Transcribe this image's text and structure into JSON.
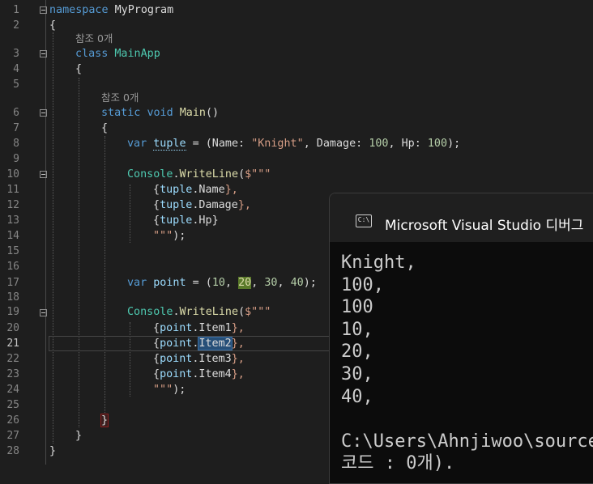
{
  "editor": {
    "current_line": 21,
    "ref_labels": {
      "line3": "참조 0개",
      "line6": "참조 0개"
    },
    "lines": {
      "l1": {
        "kw": "namespace",
        "name": "MyProgram"
      },
      "l2": "{",
      "l3": {
        "kw": "class",
        "name": "MainApp"
      },
      "l4": "{",
      "l6": {
        "kw1": "static",
        "kw2": "void",
        "name": "Main",
        "tail": "()"
      },
      "l7": "{",
      "l8": {
        "kw": "var",
        "name": "tuple",
        "p1": " = (Name: ",
        "s": "\"Knight\"",
        "p2": ", Damage: ",
        "n1": "100",
        "p3": ", Hp: ",
        "n2": "100",
        "p4": ");"
      },
      "l10": {
        "cls": "Console",
        "dot": ".",
        "fn": "WriteLine",
        "open": "(",
        "str": "$\"\"\""
      },
      "l11": {
        "open": "{",
        "v": "tuple",
        "m": ".Name",
        "close": "},"
      },
      "l12": {
        "open": "{",
        "v": "tuple",
        "m": ".Damage",
        "close": "},"
      },
      "l13": {
        "open": "{",
        "v": "tuple",
        "m": ".Hp",
        "close": "}"
      },
      "l14": {
        "str": "\"\"\"",
        "tail": ");"
      },
      "l17": {
        "kw": "var",
        "name": "point",
        "p1": " = (",
        "n1": "10",
        "c1": ", ",
        "n2": "20",
        "c2": ", ",
        "n3": "30",
        "c3": ", ",
        "n4": "40",
        "p2": ");"
      },
      "l19": {
        "cls": "Console",
        "dot": ".",
        "fn": "WriteLine",
        "open": "(",
        "str": "$\"\"\""
      },
      "l20": {
        "open": "{",
        "v": "point",
        "m": ".Item1",
        "close": "},"
      },
      "l21": {
        "open": "{",
        "v": "point",
        "dot": ".",
        "m": "Item2",
        "close": "},"
      },
      "l22": {
        "open": "{",
        "v": "point",
        "m": ".Item3",
        "close": "},"
      },
      "l23": {
        "open": "{",
        "v": "point",
        "m": ".Item4",
        "close": "},"
      },
      "l24": {
        "str": "\"\"\"",
        "tail": ");"
      },
      "l26": "}",
      "l27": "}",
      "l28": "}"
    },
    "line_numbers": [
      "1",
      "2",
      "3",
      "4",
      "5",
      "6",
      "7",
      "8",
      "9",
      "10",
      "11",
      "12",
      "13",
      "14",
      "15",
      "16",
      "17",
      "18",
      "19",
      "20",
      "21",
      "22",
      "23",
      "24",
      "25",
      "26",
      "27",
      "28"
    ]
  },
  "console": {
    "title": "Microsoft Visual Studio 디버그",
    "icon": "terminal-icon",
    "icon_text": "C:\\",
    "output": [
      "Knight,",
      "100,",
      "100",
      "10,",
      "20,",
      "30,",
      "40,",
      "",
      "C:\\Users\\Ahnjiwoo\\source",
      "코드 : 0개)."
    ]
  }
}
